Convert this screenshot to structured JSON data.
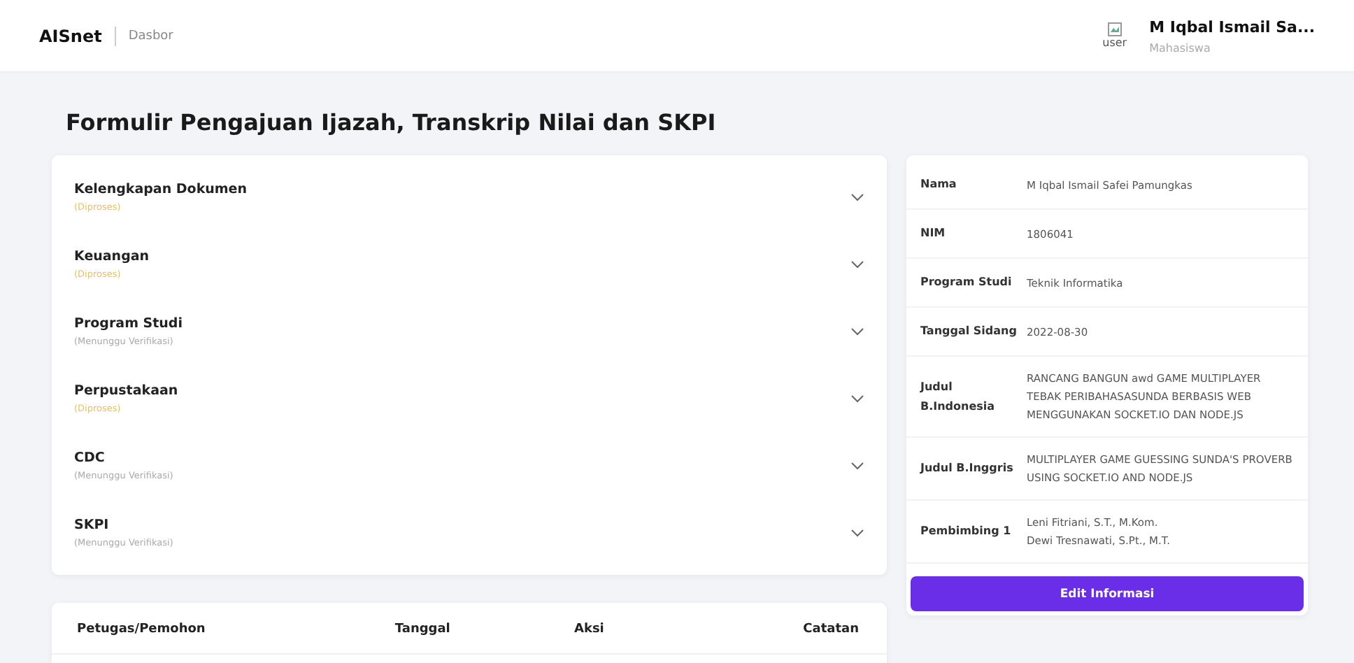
{
  "header": {
    "brand": "AISnet",
    "breadcrumb": "Dasbor",
    "avatar_alt": "user",
    "user_name": "M Iqbal Ismail Sa...",
    "user_role": "Mahasiswa"
  },
  "page_title": "Formulir Pengajuan Ijazah, Transkrip Nilai dan SKPI",
  "sections": [
    {
      "title": "Kelengkapan Dokumen",
      "status": "(Diproses)",
      "kind": "processing",
      "expanded": false
    },
    {
      "title": "Keuangan",
      "status": "(Diproses)",
      "kind": "processing",
      "expanded": false
    },
    {
      "title": "Program Studi",
      "status": "(Menunggu Verifikasi)",
      "kind": "waiting",
      "expanded": false
    },
    {
      "title": "Perpustakaan",
      "status": "(Diproses)",
      "kind": "processing",
      "expanded": false
    },
    {
      "title": "CDC",
      "status": "(Menunggu Verifikasi)",
      "kind": "waiting",
      "expanded": false
    },
    {
      "title": "SKPI",
      "status": "(Menunggu Verifikasi)",
      "kind": "waiting",
      "expanded": false
    }
  ],
  "info": [
    {
      "label": "Nama",
      "value": [
        "M Iqbal Ismail Safei Pamungkas"
      ]
    },
    {
      "label": "NIM",
      "value": [
        "1806041"
      ]
    },
    {
      "label": "Program Studi",
      "value": [
        "Teknik Informatika"
      ]
    },
    {
      "label": "Tanggal Sidang",
      "value": [
        "2022-08-30"
      ]
    },
    {
      "label": "Judul B.Indonesia",
      "value": [
        "RANCANG BANGUN awd GAME MULTIPLAYER TEBAK PERIBAHASASUNDA BERBASIS WEB MENGGUNAKAN SOCKET.IO DAN NODE.JS"
      ]
    },
    {
      "label": "Judul B.Inggris",
      "value": [
        "MULTIPLAYER GAME GUESSING SUNDA'S PROVERB USING SOCKET.IO AND NODE.JS"
      ]
    },
    {
      "label": "Pembimbing 1",
      "value": [
        "Leni Fitriani, S.T., M.Kom.",
        "Dewi Tresnawati, S.Pt., M.T."
      ]
    }
  ],
  "edit_button": "Edit Informasi",
  "log_table": {
    "columns": [
      "Petugas/Pemohon",
      "Tanggal",
      "Aksi",
      "Catatan"
    ]
  }
}
